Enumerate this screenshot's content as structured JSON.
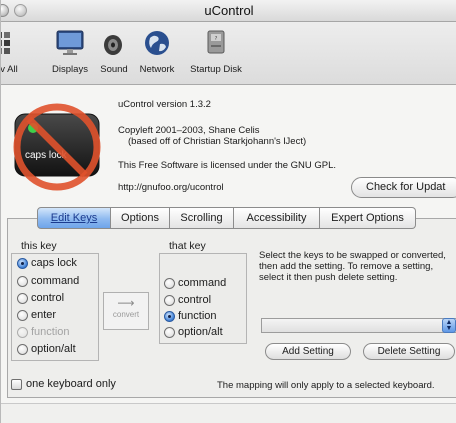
{
  "window": {
    "title": "uControl"
  },
  "toolbar": {
    "items": [
      {
        "label": "v All",
        "icon": "grid-icon"
      },
      {
        "label": "Displays",
        "icon": "display-icon"
      },
      {
        "label": "Sound",
        "icon": "speaker-icon"
      },
      {
        "label": "Network",
        "icon": "globe-icon"
      },
      {
        "label": "Startup Disk",
        "icon": "disk-icon"
      }
    ]
  },
  "info": {
    "logo_text": "caps lock",
    "version": "uControl version 1.3.2",
    "copyleft": "Copyleft 2001–2003, Shane Celis",
    "based_on": "(based off of Christian Starkjohann's Ĳect)",
    "license": "This Free Software is licensed under the GNU GPL.",
    "url": "http://gnufoo.org/ucontrol",
    "check_button": "Check for Updat"
  },
  "tabs": [
    {
      "label": "Edit Keys",
      "active": true
    },
    {
      "label": "Options",
      "active": false
    },
    {
      "label": "Scrolling",
      "active": false
    },
    {
      "label": "Accessibility",
      "active": false
    },
    {
      "label": "Expert Options",
      "active": false
    }
  ],
  "edit_keys": {
    "this_key_label": "this key",
    "this_key_options": [
      {
        "label": "caps lock",
        "selected": true,
        "enabled": true
      },
      {
        "label": "command",
        "selected": false,
        "enabled": true
      },
      {
        "label": "control",
        "selected": false,
        "enabled": true
      },
      {
        "label": "enter",
        "selected": false,
        "enabled": true
      },
      {
        "label": "function",
        "selected": false,
        "enabled": false
      },
      {
        "label": "option/alt",
        "selected": false,
        "enabled": true
      }
    ],
    "convert_label": "convert",
    "that_key_label": "that key",
    "that_key_options": [
      {
        "label": "command",
        "selected": false
      },
      {
        "label": "control",
        "selected": false
      },
      {
        "label": "function",
        "selected": true
      },
      {
        "label": "option/alt",
        "selected": false
      }
    ],
    "description": "Select the keys to be swapped or converted, then add the setting.  To remove a setting, select it then push delete setting.",
    "mapping_popup_value": "",
    "add_setting": "Add Setting",
    "delete_setting": "Delete Setting",
    "one_keyboard_only": "one keyboard only",
    "note": "The mapping will only apply to a selected keyboard."
  },
  "colors": {
    "accent": "#6ea4ea",
    "no_sign": "#e0522c"
  }
}
